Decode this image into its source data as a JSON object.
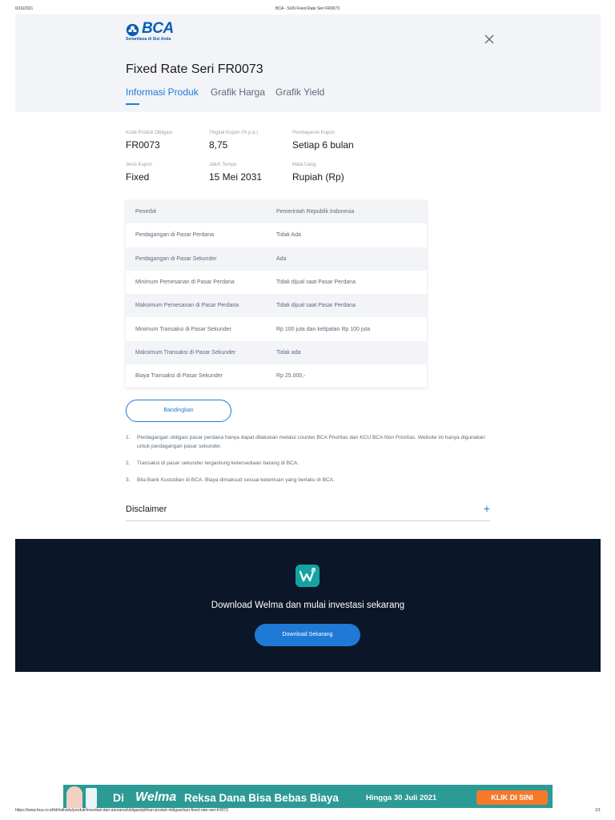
{
  "print_header": {
    "date": "6/16/2021",
    "doc_title": "BCA - SUN Fixed Rate Seri FR0073"
  },
  "print_footer": {
    "url": "https://www.bca.co.id/id/individu/produk/investasi-dan-asuransi/obligasi/pilihan-produk-obligasi/sun-fixed-rate-seri-fr0073",
    "page": "1/1"
  },
  "brand": {
    "name": "BCA",
    "tagline": "Senantiasa di Sisi Anda",
    "color": "#0a5db5"
  },
  "page_title": "Fixed Rate Seri FR0073",
  "tabs": [
    {
      "label": "Informasi Produk",
      "active": true
    },
    {
      "label": "Grafik Harga",
      "active": false
    },
    {
      "label": "Grafik Yield",
      "active": false
    }
  ],
  "info": [
    {
      "label": "Kode Produk Obligasi",
      "value": "FR0073"
    },
    {
      "label": "Tingkat Kupon (% p.a.)",
      "value": "8,75"
    },
    {
      "label": "Pembayaran Kupon",
      "value": "Setiap 6 bulan"
    },
    {
      "label": "Jenis Kupon",
      "value": "Fixed"
    },
    {
      "label": "Jatuh Tempo",
      "value": "15 Mei 2031"
    },
    {
      "label": "Mata Uang",
      "value": "Rupiah (Rp)"
    }
  ],
  "details": [
    {
      "key": "Penerbit",
      "value": "Pemerintah Republik Indonesia"
    },
    {
      "key": "Perdagangan di Pasar Perdana",
      "value": "Tidak Ada"
    },
    {
      "key": "Perdagangan di Pasar Sekunder",
      "value": "Ada"
    },
    {
      "key": "Minimum Pemesanan di Pasar Perdana",
      "value": "Tidak dijual saat Pasar Perdana"
    },
    {
      "key": "Maksimum Pemesanan di Pasar Perdana",
      "value": "Tidak dijual saat Pasar Perdana"
    },
    {
      "key": "Minimum Transaksi di Pasar Sekunder",
      "value": "Rp 100 juta dan kelipatan Rp 100 juta"
    },
    {
      "key": "Maksimum Transaksi di Pasar Sekunder",
      "value": "Tidak ada"
    },
    {
      "key": "Biaya Transaksi di Pasar Sekunder",
      "value": "Rp 25.000,-"
    }
  ],
  "compare_button": "Bandingkan",
  "notes": [
    {
      "num": "1.",
      "text": "Perdagangan obligasi pasar perdana hanya dapat dilakukan melalui counter BCA Prioritas dan KCU BCA Non Prioritas. Website ini hanya digunakan untuk perdagangan pasar sekunder."
    },
    {
      "num": "2.",
      "text": "Transaksi di pasar sekunder tergantung ketersediaan barang di BCA."
    },
    {
      "num": "3.",
      "text": "Bila Bank Kustodian di BCA. Biaya dimaksud sesuai ketentuan yang berlaku di BCA."
    }
  ],
  "disclaimer": {
    "label": "Disclaimer",
    "toggle": "+"
  },
  "download": {
    "headline": "Download Welma dan mulai investasi sekarang",
    "button": "Download Sekarang",
    "icon": "welma-app-icon"
  },
  "banner": {
    "di": "Di",
    "welma": "Welma",
    "main": "Reksa Dana Bisa Bebas Biaya",
    "date": "Hingga 30 Juli 2021",
    "cta": "KLIK DI SINI"
  },
  "colors": {
    "accent": "#1f7ad6",
    "hero_bg": "#f2f4f7",
    "dark_section": "#0b1628",
    "banner_teal": "#2c9a95",
    "banner_cta": "#f47a2a"
  }
}
